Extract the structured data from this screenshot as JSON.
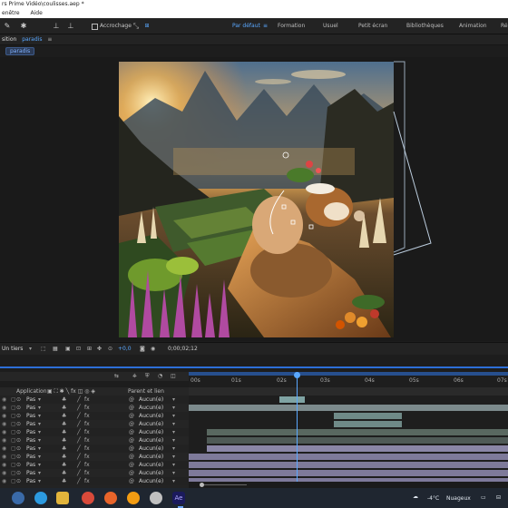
{
  "window": {
    "title": "rs Prime Vidéo\\coulisses.aep *"
  },
  "menu": {
    "items": [
      "enêtre",
      "Aide"
    ]
  },
  "toolbar": {
    "snap_label": "Accrochage",
    "workspaces": [
      "Par défaut",
      "Formation",
      "Usuel",
      "Petit écran",
      "Bibliothèques",
      "Animation",
      "Ré"
    ]
  },
  "panel": {
    "title": "sition",
    "comp_name": "paradis",
    "chip": "paradis"
  },
  "viewer": {
    "resolution": "Un tiers",
    "exposure": "+0,0",
    "timecode": "0;00;02;12"
  },
  "timeline": {
    "col_application": "Application",
    "col_parent": "Parent et lien",
    "ruler": [
      "00s",
      "01s",
      "02s",
      "03s",
      "04s",
      "05s",
      "06s",
      "07s"
    ],
    "layers": [
      {
        "mode": "Pas",
        "parent": "Aucun(e)"
      },
      {
        "mode": "Pas",
        "parent": "Aucun(e)"
      },
      {
        "mode": "Pas",
        "parent": "Aucun(e)"
      },
      {
        "mode": "Pas",
        "parent": "Aucun(e)"
      },
      {
        "mode": "Pas",
        "parent": "Aucun(e)"
      },
      {
        "mode": "Pas",
        "parent": "Aucun(e)"
      },
      {
        "mode": "Pas",
        "parent": "Aucun(e)"
      },
      {
        "mode": "Pas",
        "parent": "Aucun(e)"
      },
      {
        "mode": "Pas",
        "parent": "Aucun(e)"
      },
      {
        "mode": "Pas",
        "parent": "Aucun(e)"
      },
      {
        "mode": "Pas",
        "parent": "Aucun(e)"
      }
    ]
  },
  "taskbar": {
    "temperature": "-4°C",
    "weather": "Nuageux"
  },
  "colors": {
    "accent": "#2d6fd8",
    "active_tab": "#5aa8ff"
  }
}
